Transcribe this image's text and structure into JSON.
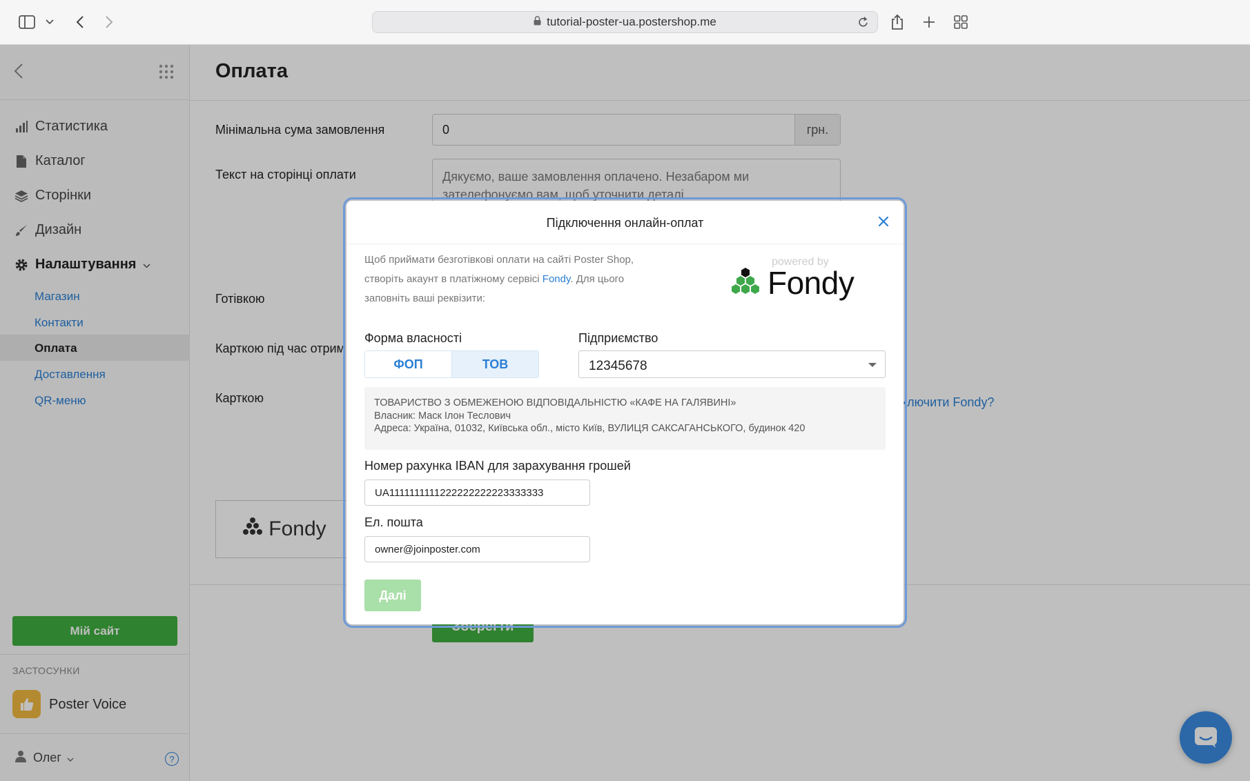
{
  "browser": {
    "url": "tutorial-poster-ua.postershop.me"
  },
  "sidebar": {
    "nav": [
      {
        "label": "Статистика",
        "icon": "bar-chart-icon"
      },
      {
        "label": "Каталог",
        "icon": "document-icon"
      },
      {
        "label": "Сторінки",
        "icon": "layers-icon"
      },
      {
        "label": "Дизайн",
        "icon": "brush-icon"
      },
      {
        "label": "Налаштування",
        "icon": "gear-icon"
      }
    ],
    "settings_sub": [
      "Магазин",
      "Контакти",
      "Оплата",
      "Доставлення",
      "QR-меню"
    ],
    "my_site_button": "Мій сайт",
    "apps_label": "ЗАСТОСУНКИ",
    "app_name": "Poster Voice",
    "user_name": "Олег",
    "help_icon_text": "?"
  },
  "main": {
    "page_title": "Оплата",
    "min_order_label": "Мінімальна сума замовлення",
    "min_order_value": "0",
    "currency": "грн.",
    "payment_text_label": "Текст на сторінці оплати",
    "payment_text_value": "Дякуємо, ваше замовлення оплачено. Незабаром ми зателефонуємо вам, щоб уточнити деталі.",
    "cash_label": "Готівкою",
    "card_on_delivery_label": "Карткою під час отрим",
    "card_label": "Карткою",
    "fondy_card_label": "Fondy",
    "connect_link": "ключити Fondy?",
    "save_button": "Зберегти"
  },
  "modal": {
    "title": "Підключення онлайн-оплат",
    "intro_before": "Щоб приймати безготівкові оплати на сайті Poster Shop, створіть акаунт в платіжному сервісі ",
    "intro_link": "Fondy",
    "intro_after": ". Для цього заповніть ваші реквізити:",
    "powered_by": "powered by",
    "logo_text": "Fondy",
    "ownership_label": "Форма власності",
    "ownership_options": [
      "ФОП",
      "ТОВ"
    ],
    "ownership_selected": "ТОВ",
    "enterprise_label": "Підприємство",
    "enterprise_value": "12345678",
    "company_name": "ТОВАРИСТВО З ОБМЕЖЕНОЮ ВІДПОВІДАЛЬНІСТЮ «КАФЕ НА ГАЛЯВИНІ»",
    "company_owner": "Власник: Маск Ілон Теслович",
    "company_address": "Адреса: Україна, 01032, Київська обл., місто Київ, ВУЛИЦЯ САКСАГАНСЬКОГО, будинок 420",
    "iban_label": "Номер рахунка IBAN для зарахування грошей",
    "iban_value": "UA1111111111222222222223333333",
    "email_label": "Ел. пошта",
    "email_value": "owner@joinposter.com",
    "next_button": "Далі"
  },
  "colors": {
    "accent_blue": "#2a7fd4",
    "green": "#3fae3f",
    "modal_ring": "#6e9ad8",
    "fondy_green": "#3ea84a"
  }
}
